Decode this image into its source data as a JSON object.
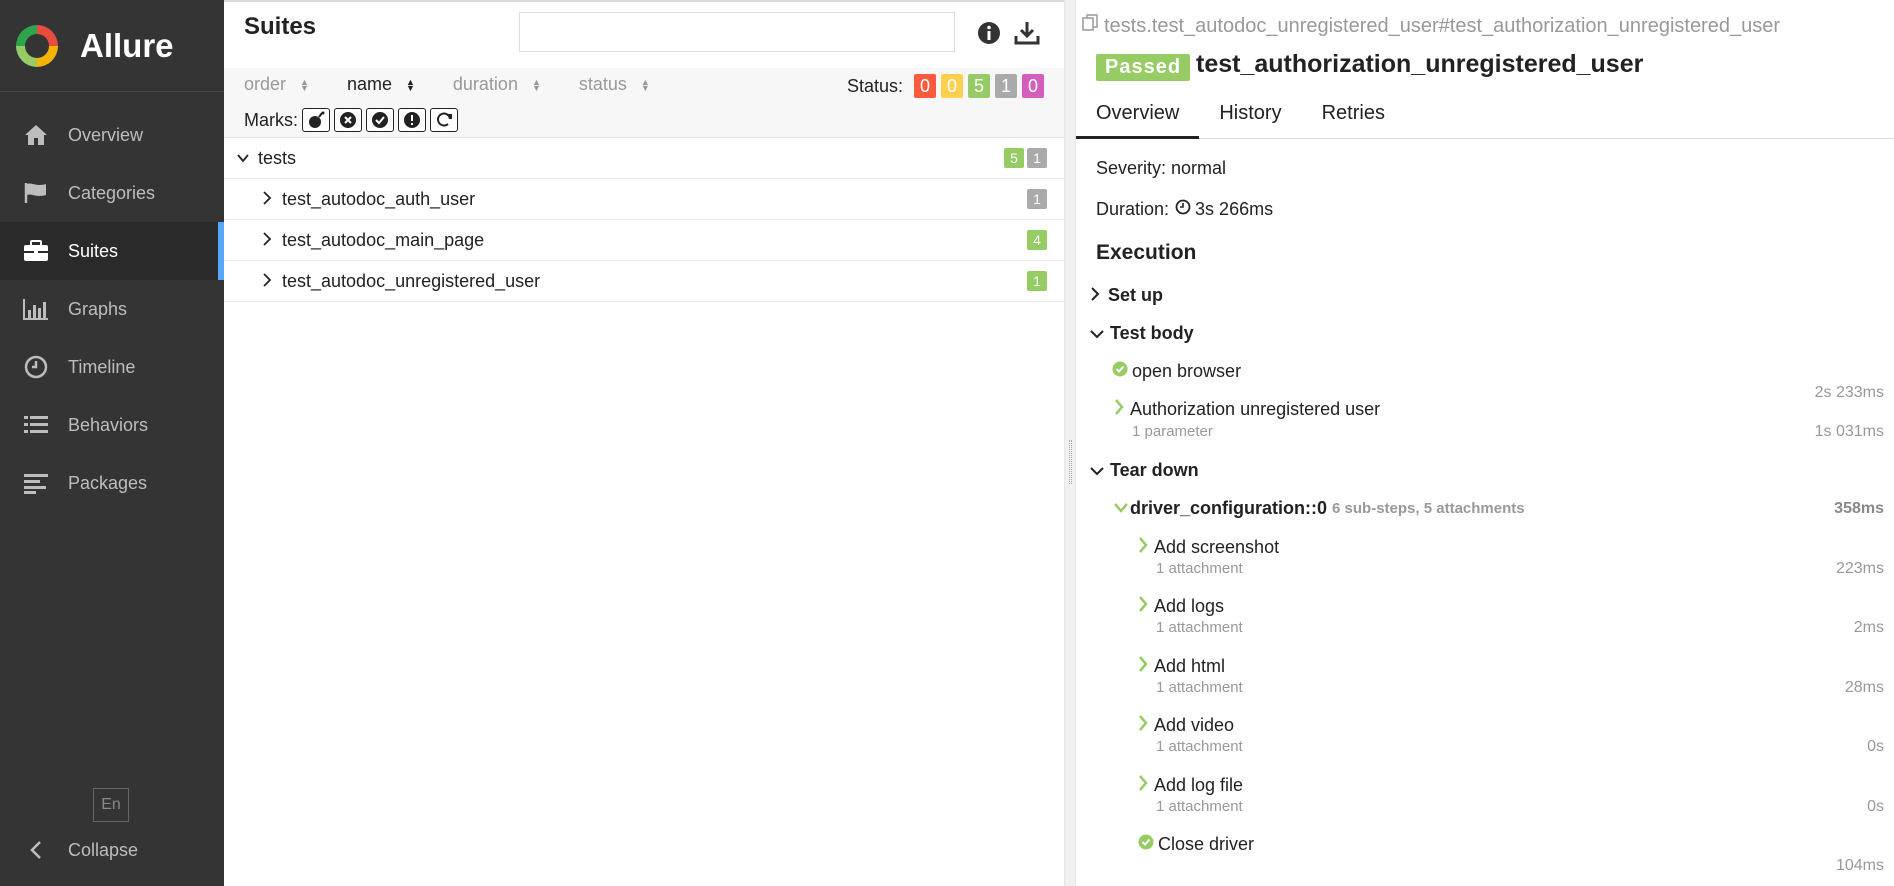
{
  "app": {
    "name": "Allure",
    "accent": "#5aa7ff"
  },
  "nav": [
    {
      "label": "Overview",
      "icon": "home-icon"
    },
    {
      "label": "Categories",
      "icon": "flag-icon"
    },
    {
      "label": "Suites",
      "icon": "briefcase-icon",
      "active": true
    },
    {
      "label": "Graphs",
      "icon": "bar-chart-icon"
    },
    {
      "label": "Timeline",
      "icon": "clock-icon"
    },
    {
      "label": "Behaviors",
      "icon": "list-icon"
    },
    {
      "label": "Packages",
      "icon": "align-left-icon"
    }
  ],
  "lang": "En",
  "collapse_label": "Collapse",
  "suites": {
    "title": "Suites",
    "search_value": "",
    "sort": {
      "order": "order",
      "name": "name",
      "duration": "duration",
      "status": "status"
    },
    "status_label": "Status:",
    "status_counts": [
      {
        "value": "0",
        "color": "#fd5a3e"
      },
      {
        "value": "0",
        "color": "#ffd050"
      },
      {
        "value": "5",
        "color": "#97cc64"
      },
      {
        "value": "1",
        "color": "#aaaaaa"
      },
      {
        "value": "0",
        "color": "#d35ebe"
      }
    ],
    "marks_label": "Marks:",
    "tree": {
      "root": {
        "label": "tests",
        "counts": [
          {
            "value": "5",
            "color": "#97cc64"
          },
          {
            "value": "1",
            "color": "#aaaaaa"
          }
        ]
      },
      "children": [
        {
          "label": "test_autodoc_auth_user",
          "count": "1",
          "color": "#aaaaaa"
        },
        {
          "label": "test_autodoc_main_page",
          "count": "4",
          "color": "#97cc64"
        },
        {
          "label": "test_autodoc_unregistered_user",
          "count": "1",
          "color": "#97cc64"
        }
      ]
    }
  },
  "detail": {
    "path": "tests.test_autodoc_unregistered_user#test_authorization_unregistered_user",
    "status": "Passed",
    "title": "test_authorization_unregistered_user",
    "tabs": [
      "Overview",
      "History",
      "Retries"
    ],
    "severity": "Severity: normal",
    "duration_label": "Duration:",
    "duration_value": "3s 266ms",
    "execution": "Execution",
    "setup": "Set up",
    "test_body": "Test body",
    "open_browser": "open browser",
    "open_browser_dur": "2s 233ms",
    "auth_step": "Authorization unregistered user",
    "auth_param": "1 parameter",
    "auth_dur": "1s 031ms",
    "teardown": "Tear down",
    "driver_conf": "driver_configuration::0",
    "driver_meta": "6 sub-steps, 5 attachments",
    "driver_dur": "358ms",
    "substeps": [
      {
        "label": "Add screenshot",
        "sub": "1 attachment",
        "dur": "223ms"
      },
      {
        "label": "Add logs",
        "sub": "1 attachment",
        "dur": "2ms"
      },
      {
        "label": "Add html",
        "sub": "1 attachment",
        "dur": "28ms"
      },
      {
        "label": "Add video",
        "sub": "1 attachment",
        "dur": "0s"
      },
      {
        "label": "Add log file",
        "sub": "1 attachment",
        "dur": "0s"
      }
    ],
    "close_driver": "Close driver",
    "close_driver_dur": "104ms"
  }
}
